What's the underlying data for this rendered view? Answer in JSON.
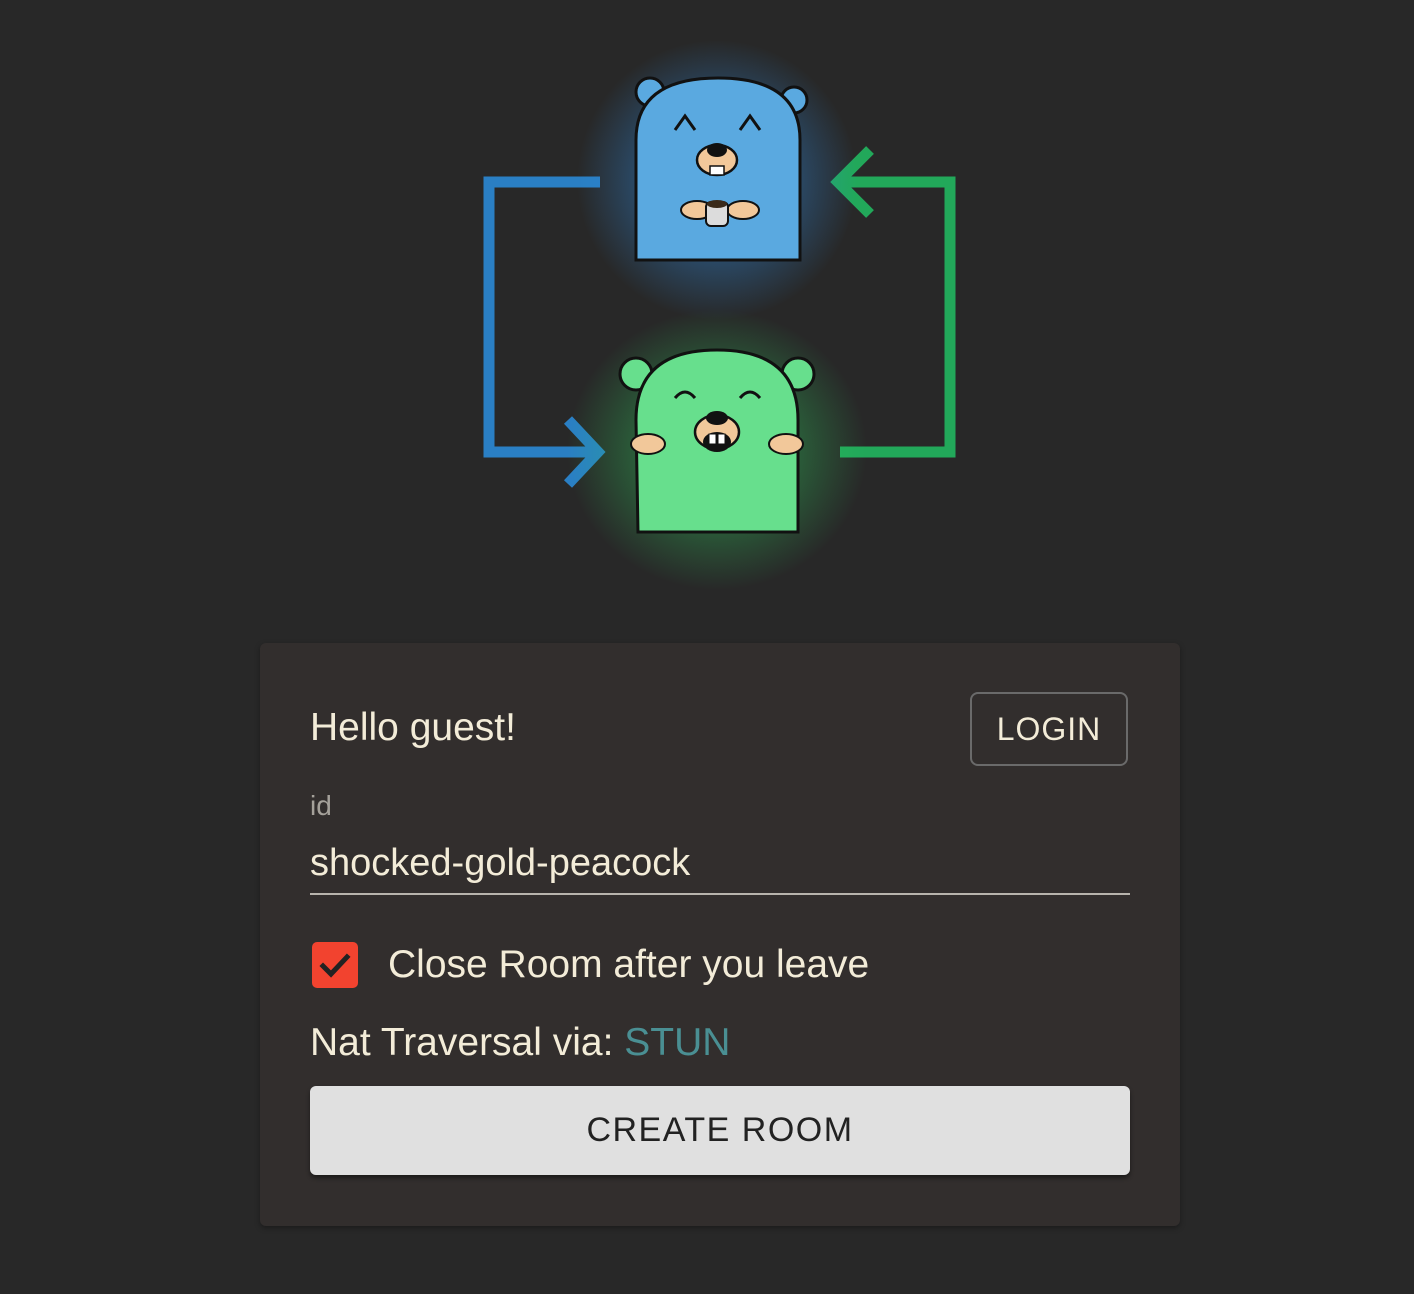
{
  "logo": {
    "icons": [
      "blue-gopher-icon",
      "green-gopher-icon",
      "blue-arrow-icon",
      "green-arrow-icon"
    ],
    "colors": {
      "blue_gopher": "#5aa9e0",
      "blue_glow": "#2e8be0",
      "blue_arrow": "#2a7fc4",
      "green_gopher": "#67df8d",
      "green_glow": "#2ed15f",
      "green_arrow": "#22a85a"
    }
  },
  "card": {
    "greeting": "Hello guest!",
    "login_label": "LOGIN",
    "id_field": {
      "label": "id",
      "value": "shocked-gold-peacock"
    },
    "close_room": {
      "label": "Close Room after you leave",
      "checked": true,
      "color": "#f2432f"
    },
    "nat": {
      "label": "Nat Traversal via:",
      "value": "STUN",
      "value_color": "#4a8f93"
    },
    "create_label": "CREATE ROOM"
  }
}
